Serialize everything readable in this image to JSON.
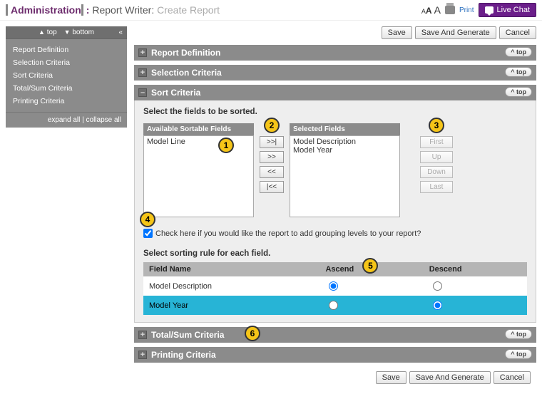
{
  "header": {
    "admin": "Administration",
    "section": "Report Writer",
    "page": "Create Report",
    "print": "Print",
    "live_chat": "Live Chat"
  },
  "sidebar": {
    "top_label": "top",
    "bottom_label": "bottom",
    "items": [
      "Report Definition",
      "Selection Criteria",
      "Sort Criteria",
      "Total/Sum Criteria",
      "Printing Criteria"
    ],
    "expand_all": "expand all",
    "collapse_all": "collapse all"
  },
  "actions": {
    "save": "Save",
    "save_generate": "Save And Generate",
    "cancel": "Cancel"
  },
  "panels": {
    "report_def": "Report Definition",
    "selection": "Selection Criteria",
    "sort": "Sort Criteria",
    "totalsum": "Total/Sum Criteria",
    "printing": "Printing Criteria",
    "top_btn": "^ top"
  },
  "sort": {
    "instruction": "Select the fields to be sorted.",
    "avail_title": "Available Sortable Fields",
    "sel_title": "Selected Fields",
    "available": [
      "Model Line"
    ],
    "selected": [
      "Model Description",
      "Model Year"
    ],
    "move_all_right": ">>|",
    "move_right": ">>",
    "move_left": "<<",
    "move_all_left": "|<<",
    "first": "First",
    "up": "Up",
    "down": "Down",
    "last": "Last",
    "grouping_checkbox": "Check here if you would like the report to add grouping levels to your report?",
    "rule_heading": "Select sorting rule for each field.",
    "col_field": "Field Name",
    "col_asc": "Ascend",
    "col_desc": "Descend",
    "rows": [
      {
        "field": "Model Description",
        "ascend": true
      },
      {
        "field": "Model Year",
        "ascend": false
      }
    ]
  },
  "markers": {
    "m1": "1",
    "m2": "2",
    "m3": "3",
    "m4": "4",
    "m5": "5",
    "m6": "6"
  }
}
